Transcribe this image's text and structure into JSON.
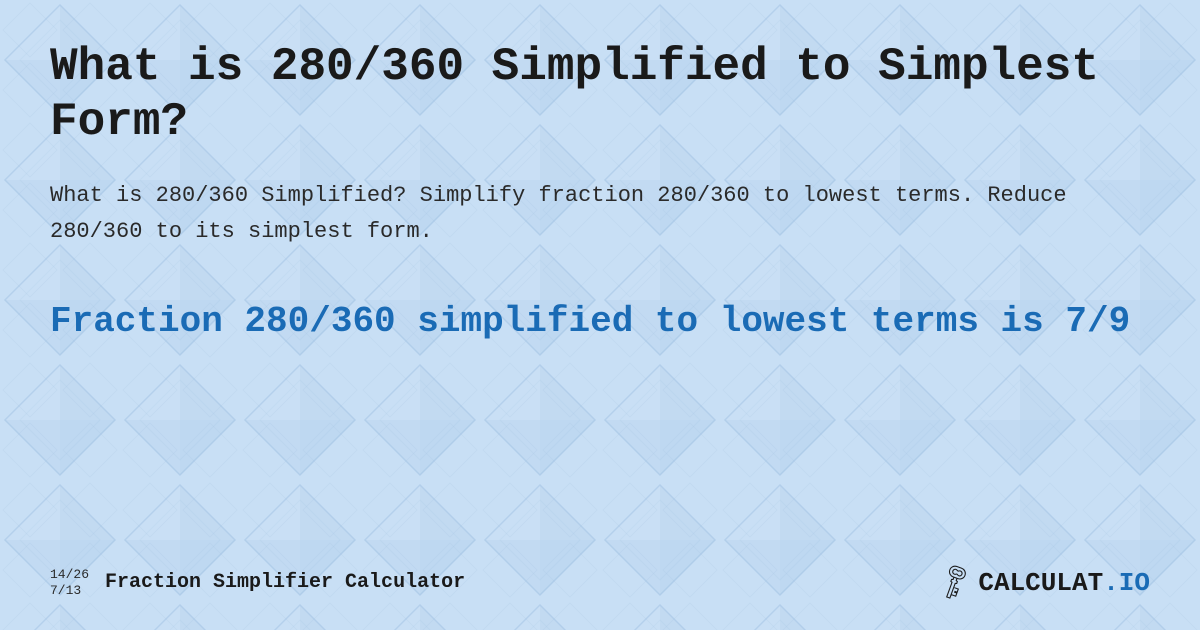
{
  "background": {
    "color": "#c8dff5",
    "pattern": "diamond-triangles"
  },
  "title": "What is 280/360 Simplified to Simplest Form?",
  "description": "What is 280/360 Simplified? Simplify fraction 280/360 to lowest terms. Reduce 280/360 to its simplest form.",
  "result": "Fraction 280/360 simplified to lowest terms is 7/9",
  "footer": {
    "fraction_top": "14/26",
    "fraction_bottom": "7/13",
    "brand_label": "Fraction Simplifier Calculator",
    "logo_icon": "🗝",
    "logo_text_part1": "CALCULAT",
    "logo_text_part2": ".IO"
  }
}
